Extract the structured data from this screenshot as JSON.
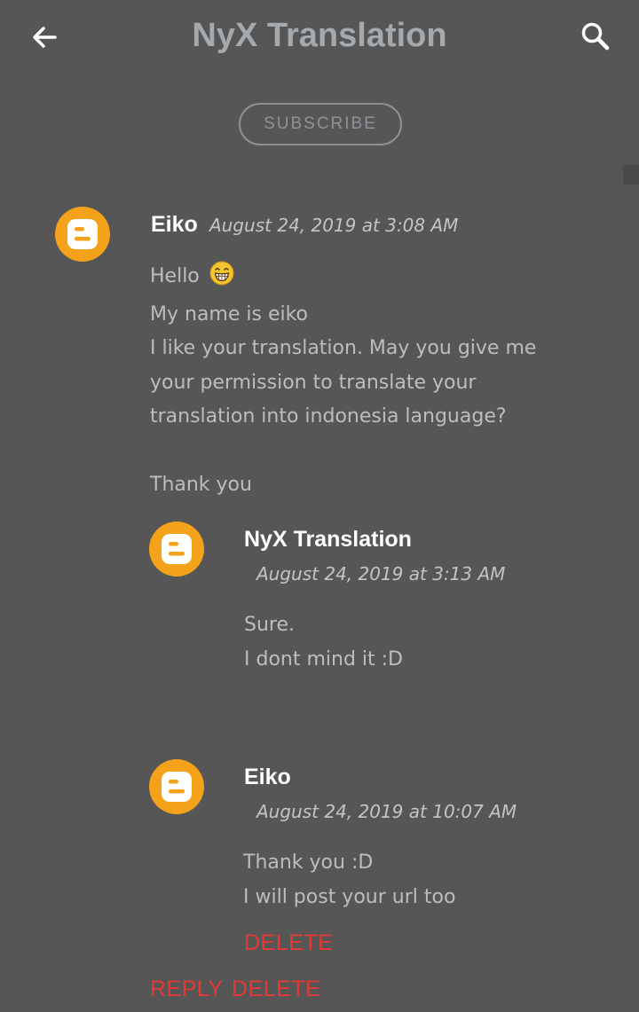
{
  "header": {
    "title": "NyX Translation",
    "back_icon": "arrow-left-icon",
    "search_icon": "search-icon"
  },
  "subscribe": {
    "label": "SUBSCRIBE"
  },
  "colors": {
    "background": "#565656",
    "avatar": "#f5a21b",
    "action": "#e53935"
  },
  "comments": [
    {
      "author": "Eiko",
      "timestamp": "August 24, 2019 at 3:08 AM",
      "avatar_icon": "blogger-icon",
      "lines": [
        "Hello",
        "My name is eiko",
        "I like your translation. May you give me",
        "your permission to translate your",
        "translation into indonesia language?",
        "",
        "Thank you"
      ],
      "emoji": "grinning-face-emoji",
      "actions": {
        "reply": "REPLY",
        "delete": "DELETE"
      },
      "replies": [
        {
          "author": "NyX Translation",
          "timestamp": "August 24, 2019 at 3:13 AM",
          "avatar_icon": "blogger-icon",
          "lines": [
            "Sure.",
            "I dont mind it :D"
          ]
        },
        {
          "author": "Eiko",
          "timestamp": "August 24, 2019 at 10:07 AM",
          "avatar_icon": "blogger-icon",
          "lines": [
            "Thank you :D",
            "I will post your url too"
          ],
          "actions": {
            "delete": "DELETE"
          }
        }
      ]
    }
  ]
}
